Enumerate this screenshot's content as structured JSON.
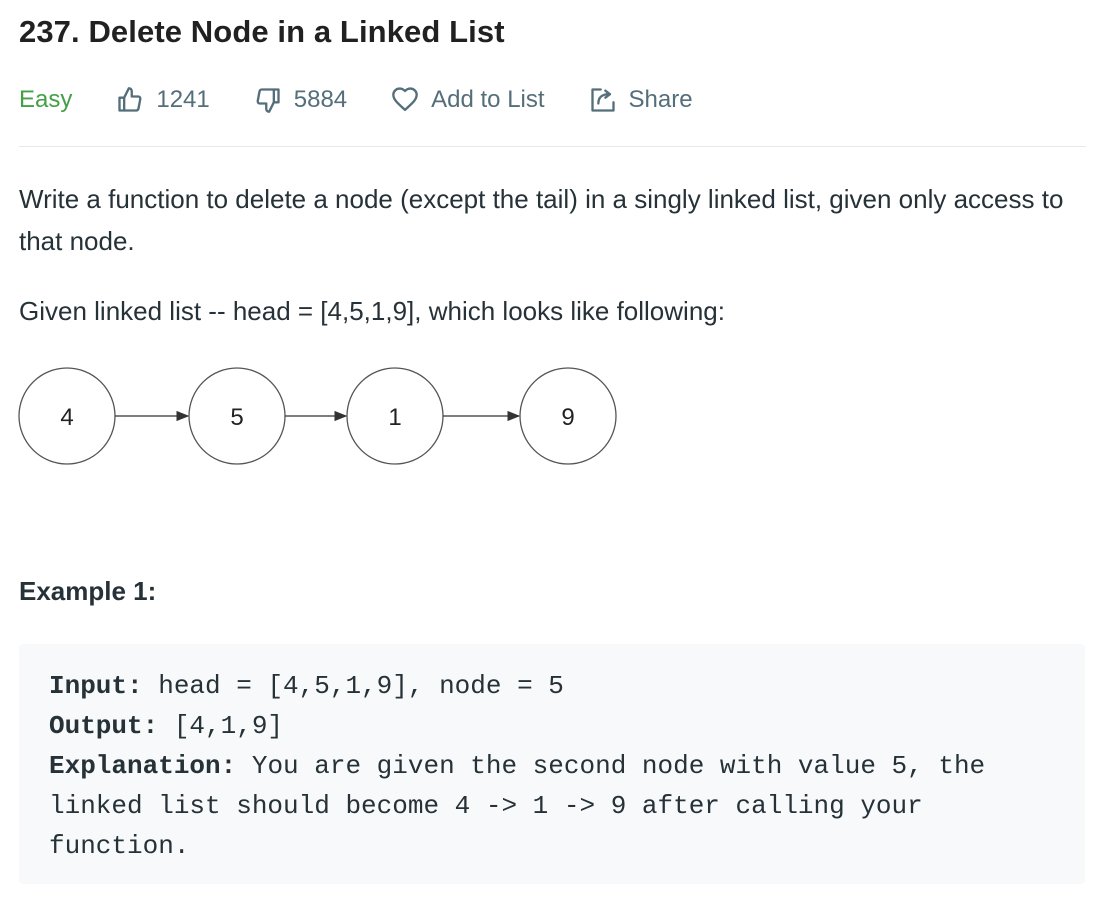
{
  "problem": {
    "title": "237. Delete Node in a Linked List",
    "difficulty": "Easy",
    "likes": "1241",
    "dislikes": "5884",
    "add_to_list_label": "Add to List",
    "share_label": "Share"
  },
  "description": {
    "paragraph1": "Write a function to delete a node (except the tail) in a singly linked list, given only access to that node.",
    "paragraph2": "Given linked list -- head = [4,5,1,9], which looks like following:"
  },
  "diagram": {
    "nodes": [
      "4",
      "5",
      "1",
      "9"
    ]
  },
  "example": {
    "title": "Example 1:",
    "input_label": "Input:",
    "input_value": " head = [4,5,1,9], node = 5",
    "output_label": "Output:",
    "output_value": " [4,1,9]",
    "explanation_label": "Explanation:",
    "explanation_value": " You are given the second node with value 5, the linked list should become 4 -> 1 -> 9 after calling your function."
  },
  "icons": {
    "like": "thumbs-up-icon",
    "dislike": "thumbs-down-icon",
    "add_to_list": "heart-icon",
    "share": "share-icon"
  },
  "colors": {
    "difficulty_easy": "#43a047",
    "meta_text": "#546e7a",
    "code_bg": "#f7f9fa"
  }
}
